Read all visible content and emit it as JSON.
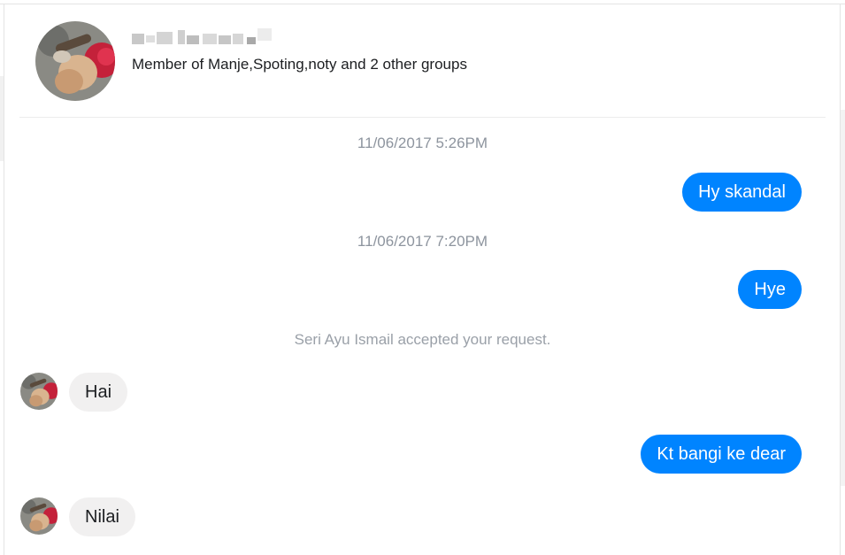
{
  "contact": {
    "name": "",
    "subtitle": "Member of Manje,Spoting,noty and 2 other groups"
  },
  "messages": [
    {
      "type": "timestamp",
      "text": "11/06/2017 5:26PM"
    },
    {
      "type": "outgoing",
      "text": "Hy skandal"
    },
    {
      "type": "timestamp",
      "text": "11/06/2017 7:20PM"
    },
    {
      "type": "outgoing",
      "text": "Hye"
    },
    {
      "type": "system",
      "text": "Seri Ayu Ismail accepted your request."
    },
    {
      "type": "incoming",
      "text": "Hai"
    },
    {
      "type": "outgoing",
      "text": "Kt bangi ke dear"
    },
    {
      "type": "incoming",
      "text": "Nilai"
    }
  ],
  "colors": {
    "outgoing_bubble": "#0084ff",
    "incoming_bubble": "#f1f0f0",
    "timestamp_text": "#8d949e"
  }
}
